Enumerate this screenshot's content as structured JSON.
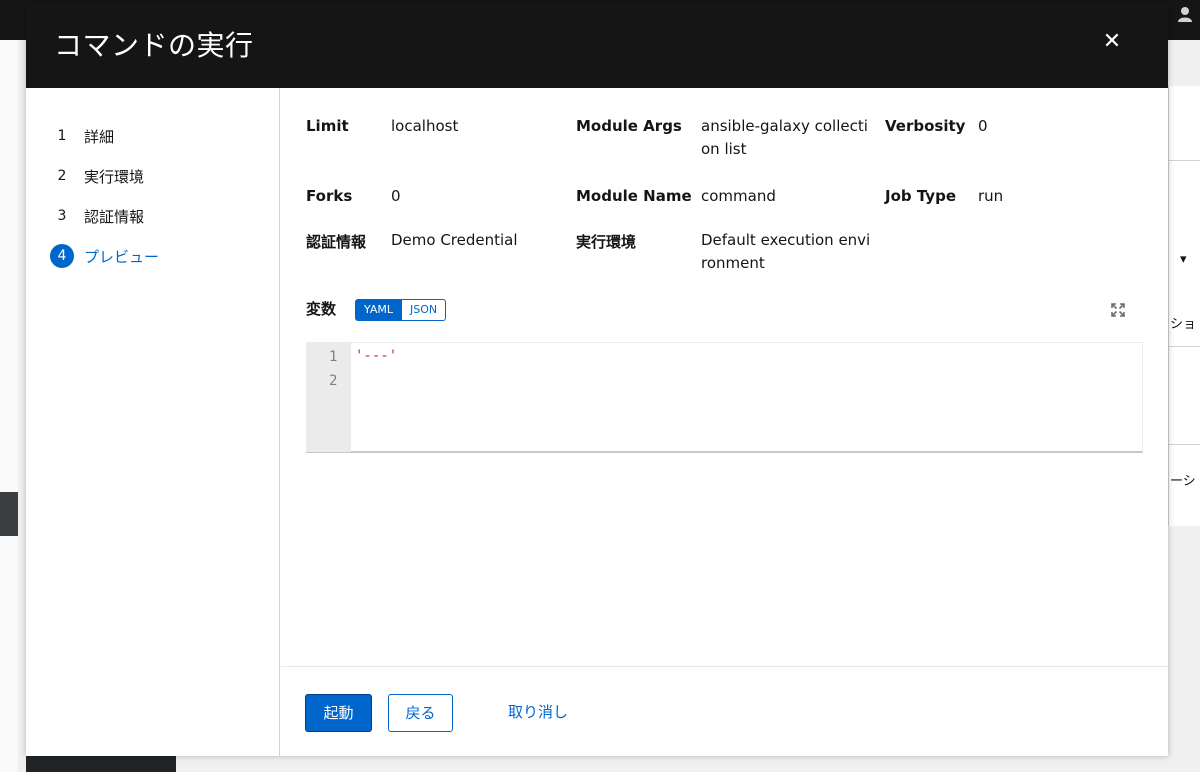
{
  "modal": {
    "title": "コマンドの実行",
    "close_symbol": "✕"
  },
  "steps": [
    {
      "num": "1",
      "label": "詳細"
    },
    {
      "num": "2",
      "label": "実行環境"
    },
    {
      "num": "3",
      "label": "認証情報"
    },
    {
      "num": "4",
      "label": "プレビュー",
      "active": true
    }
  ],
  "details": {
    "limit": {
      "label": "Limit",
      "value": "localhost"
    },
    "module_args": {
      "label": "Module Args",
      "value_line1": "ansible-galaxy collecti",
      "value_line2": "on list"
    },
    "verbosity": {
      "label": "Verbosity",
      "value": "0"
    },
    "forks": {
      "label": "Forks",
      "value": "0"
    },
    "module_name": {
      "label": "Module Name",
      "value": "command"
    },
    "job_type": {
      "label": "Job Type",
      "value": "run"
    },
    "credential": {
      "label": "認証情報",
      "value": "Demo Credential"
    },
    "exec_env": {
      "label": "実行環境",
      "value_line1": "Default execution envi",
      "value_line2": "ronment"
    }
  },
  "variables": {
    "label": "変数",
    "yaml_label": "YAML",
    "json_label": "JSON",
    "line_numbers": [
      "1",
      "2"
    ],
    "code_line1": "'---'"
  },
  "footer": {
    "launch": "起動",
    "back": "戻る",
    "cancel": "取り消し"
  },
  "background": {
    "frag1": "ショ",
    "frag2": "ーシ"
  }
}
